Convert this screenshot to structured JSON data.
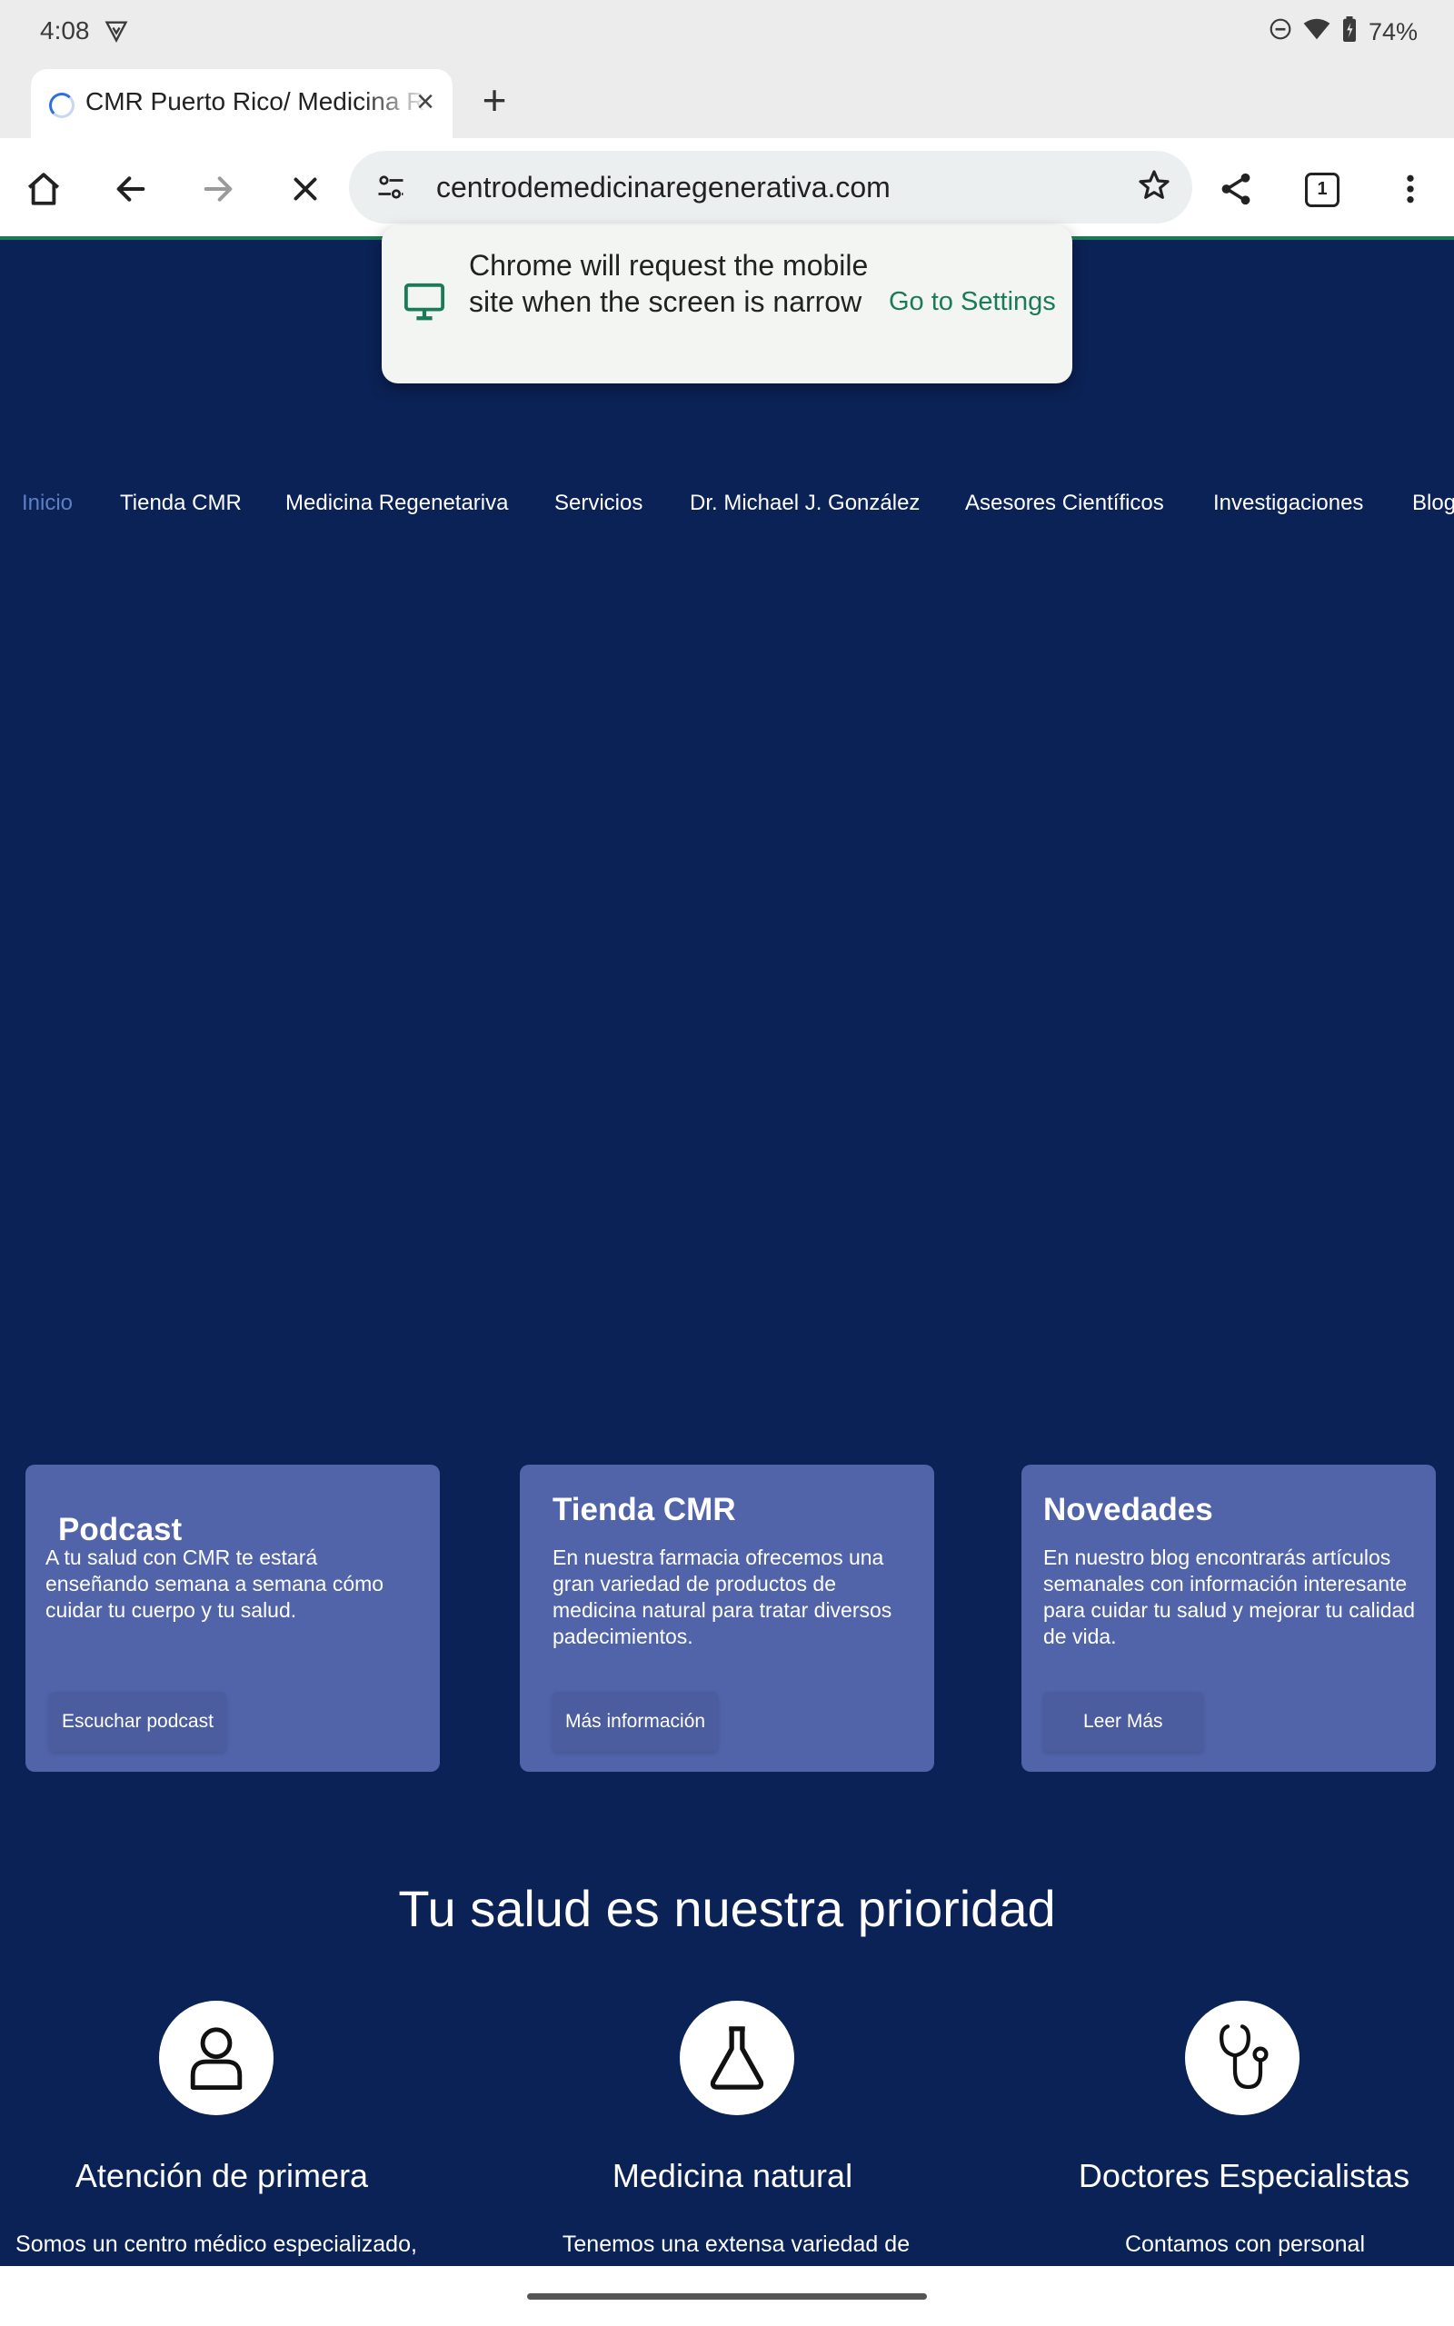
{
  "status_bar": {
    "time": "4:08",
    "battery": "74%"
  },
  "browser": {
    "tab": {
      "title": "CMR Puerto Rico/ Medicina Regenerativa",
      "close_glyph": "×"
    },
    "new_tab_glyph": "+",
    "url": "centrodemedicinaregenerativa.com",
    "tab_count": "1",
    "popup": {
      "message": "Chrome will request the mobile site when the screen is narrow",
      "action": "Go to Settings"
    }
  },
  "site": {
    "nav": [
      {
        "label": "Inicio",
        "active": true
      },
      {
        "label": "Tienda CMR"
      },
      {
        "label": "Medicina Regenetariva"
      },
      {
        "label": "Servicios"
      },
      {
        "label": "Dr. Michael J. González"
      },
      {
        "label": "Asesores Científicos"
      },
      {
        "label": "Investigaciones"
      },
      {
        "label": "Blog"
      }
    ],
    "cards": [
      {
        "title": "Podcast",
        "text": "A tu salud con CMR te estará enseñando semana a semana cómo cuidar tu cuerpo y tu salud.",
        "button": "Escuchar podcast"
      },
      {
        "title": "Tienda CMR",
        "text": "En nuestra farmacia ofrecemos una gran variedad de productos de medicina natural para tratar diversos padecimientos.",
        "button": "Más información"
      },
      {
        "title": "Novedades",
        "text": "En nuestro blog encontrarás artículos semanales con información interesante para cuidar tu salud y mejorar tu calidad de vida.",
        "button": "Leer Más"
      }
    ],
    "section_heading": "Tu salud es nuestra prioridad",
    "features": [
      {
        "title": "Atención de primera",
        "text": "Somos un centro médico especializado,",
        "icon": "person-icon"
      },
      {
        "title": "Medicina natural",
        "text": "Tenemos una extensa variedad de",
        "icon": "flask-icon"
      },
      {
        "title": "Doctores Especialistas",
        "text": "Contamos con personal",
        "icon": "stethoscope-icon"
      }
    ]
  },
  "colors": {
    "page_background": "#0b2256",
    "card_background": "#5164aa",
    "accent_green": "#1b7a5a",
    "nav_active": "#5e7fc4"
  }
}
